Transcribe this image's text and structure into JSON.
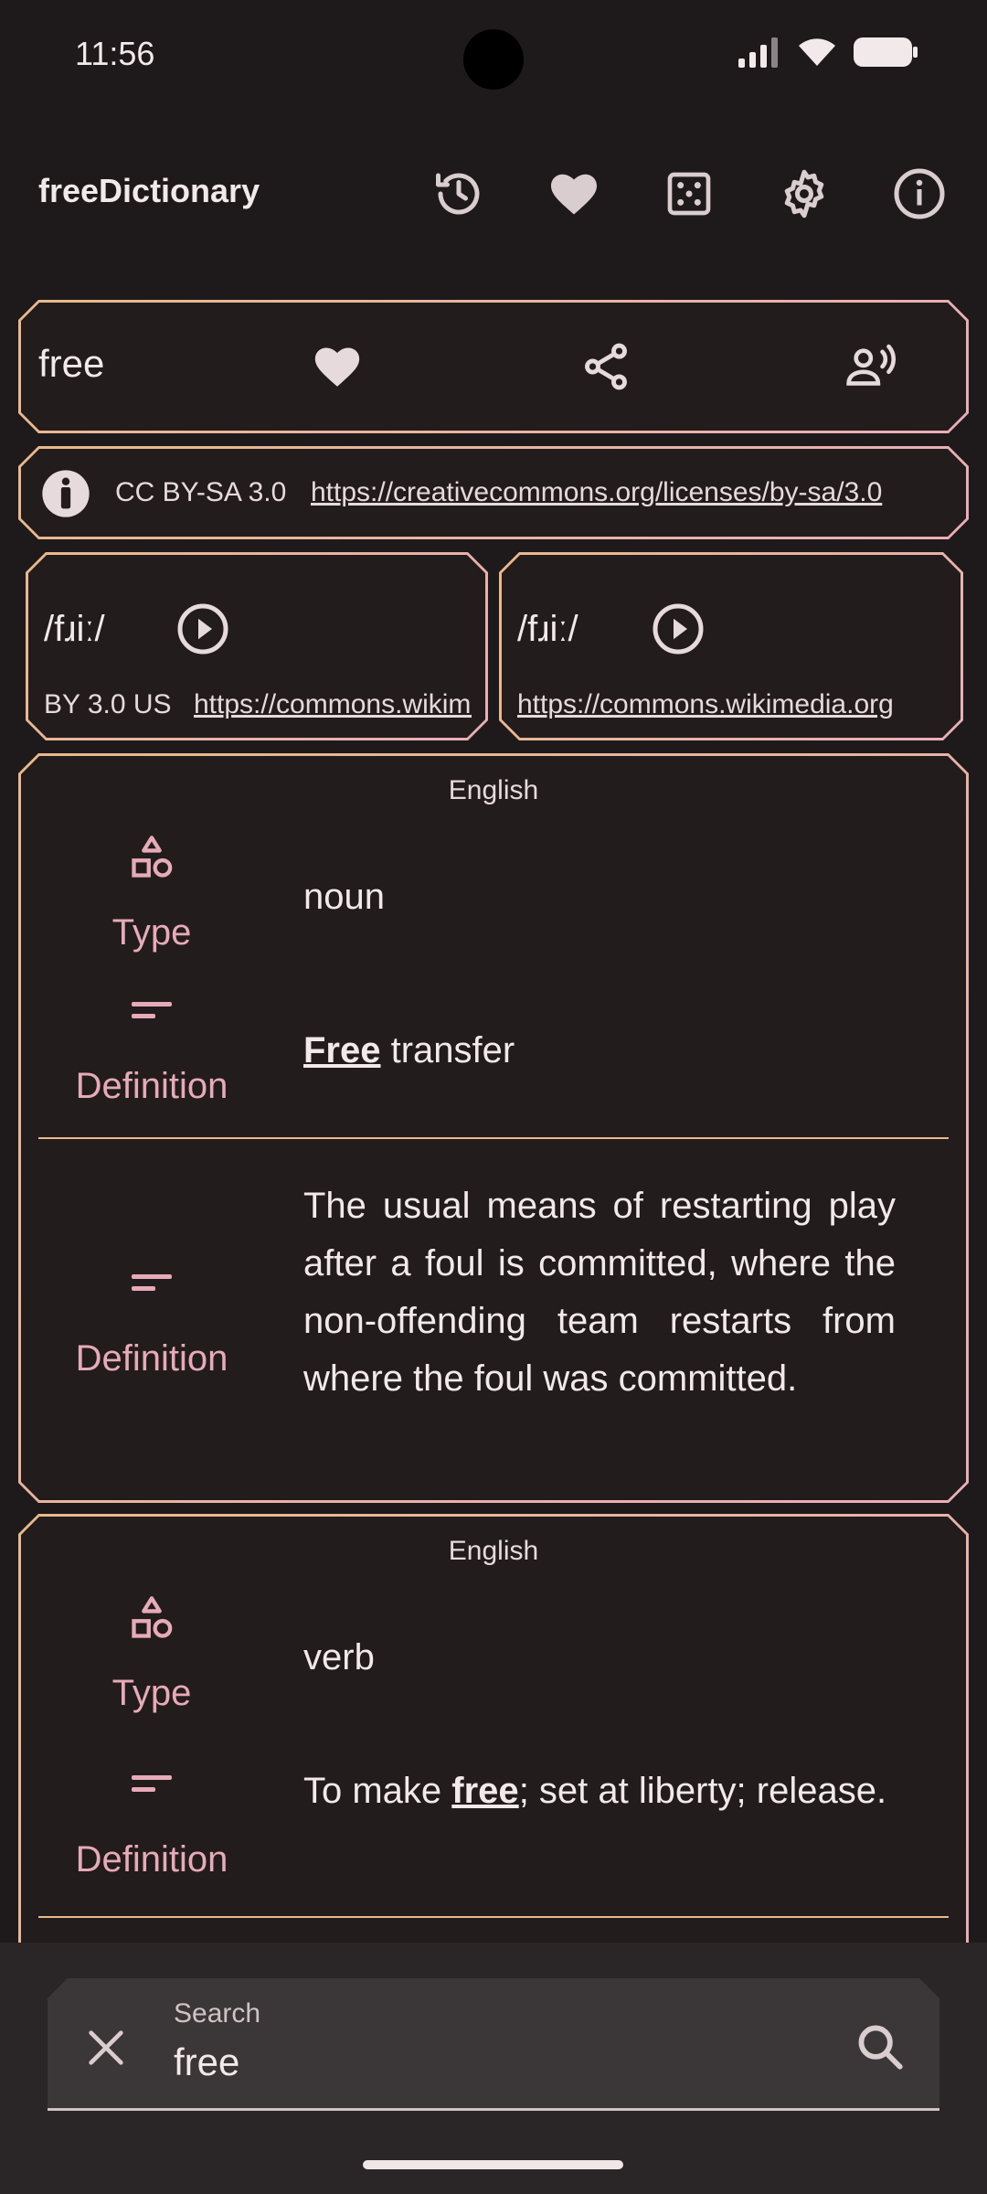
{
  "status": {
    "time": "11:56"
  },
  "app": {
    "title": "freeDictionary"
  },
  "appbar_icons": [
    "history-icon",
    "heart-icon",
    "dice-icon",
    "gear-icon",
    "info-icon"
  ],
  "word_card": {
    "word": "free",
    "icons": [
      "heart-icon",
      "share-icon",
      "voice-icon"
    ]
  },
  "license": {
    "name": "CC BY-SA 3.0",
    "url": "https://creativecommons.org/licenses/by-sa/3.0"
  },
  "phonetics": [
    {
      "text": "/fɹiː/",
      "license": "BY 3.0 US",
      "url": "https://commons.wikimedia.org"
    },
    {
      "text": "/fɹiː/",
      "license": "",
      "url": "https://commons.wikimedia.org"
    }
  ],
  "meanings": [
    {
      "language": "English",
      "type_label": "Type",
      "type": "noun",
      "definition_label": "Definition",
      "definitions": [
        {
          "bold": "Free",
          "after": " transfer"
        },
        {
          "text": "The usual means of restarting play after a foul is committed, where the non-offending team restarts from where the foul was committed."
        }
      ]
    },
    {
      "language": "English",
      "type_label": "Type",
      "type": "verb",
      "definition_label": "Definition",
      "definitions": [
        {
          "before": "To make ",
          "bold": "free",
          "after": "; set at liberty; release."
        }
      ]
    }
  ],
  "search": {
    "label": "Search",
    "value": "free"
  },
  "colors": {
    "background": "#1e1a1b",
    "accent_orange": "#e9b98a",
    "accent_pink": "#e6aab8"
  }
}
